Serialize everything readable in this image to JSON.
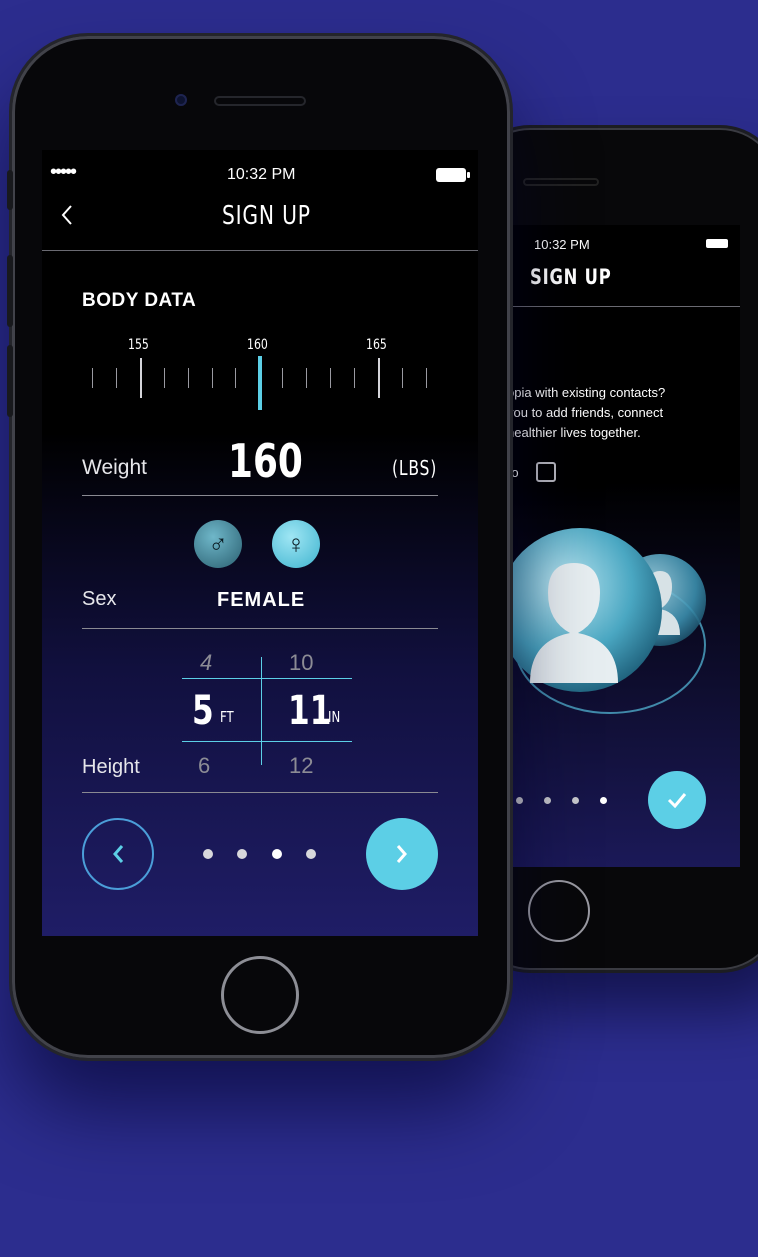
{
  "back_phone": {
    "time": "10:32 PM",
    "title": "SIGN UP",
    "question_line1": "opia with existing contacts?",
    "question_line2": "you to add friends, connect",
    "question_line3": "healthier lives together.",
    "no_label": "No",
    "confirm_icon": "check-icon",
    "pager": {
      "count": 5,
      "active_index": 4
    }
  },
  "front_phone": {
    "status": {
      "signal": "•••••",
      "time": "10:32 PM",
      "battery_icon": "battery-icon"
    },
    "nav": {
      "back_icon": "chevron-left-icon",
      "title": "SIGN UP"
    },
    "section_title": "BODY DATA",
    "ruler": {
      "labels": [
        "155",
        "160",
        "165"
      ],
      "selected": 160
    },
    "weight": {
      "label": "Weight",
      "value": "160",
      "unit": "(LBS)"
    },
    "sex": {
      "label": "Sex",
      "value": "FEMALE",
      "male_icon": "male-symbol-icon",
      "female_icon": "female-symbol-icon",
      "selected": "female"
    },
    "height": {
      "label": "Height",
      "feet": {
        "above": "4",
        "value": "5",
        "unit": "FT",
        "below": "6"
      },
      "inches": {
        "above": "10",
        "value": "11",
        "unit": "IN",
        "below": "12"
      }
    },
    "pager": {
      "count": 4,
      "active_index": 2
    },
    "colors": {
      "accent": "#5ccfe6",
      "background": "#2c2d8e"
    }
  }
}
